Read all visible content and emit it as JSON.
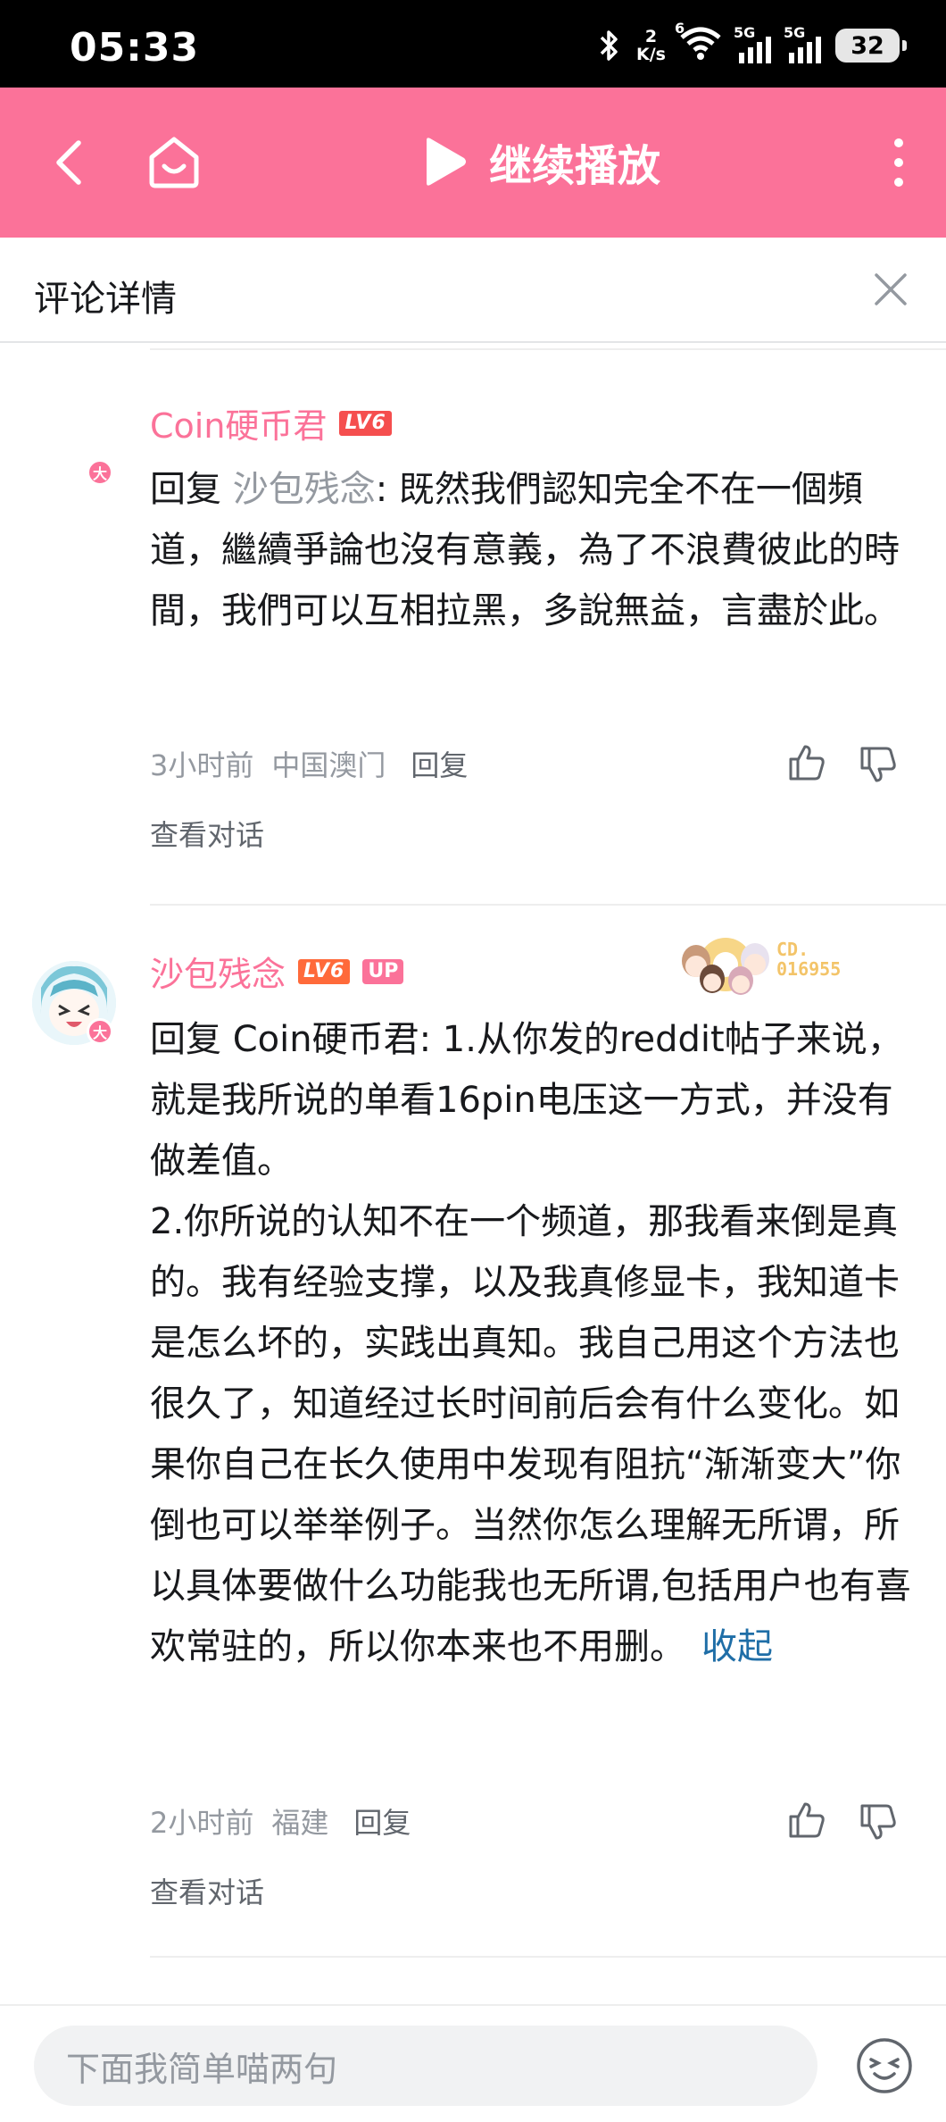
{
  "status_bar": {
    "time": "05:33",
    "net_speed_value": "2",
    "net_speed_unit": "K/s",
    "wifi_label": "6",
    "sim1_label": "5G",
    "sim2_label": "5G",
    "battery": "32"
  },
  "header": {
    "play_title": "继续播放",
    "background_color": "#fb7299"
  },
  "subheader": {
    "title": "评论详情"
  },
  "comments": [
    {
      "username": "Coin硬币君",
      "level": "LV6",
      "badge_letter": "大",
      "reply_prefix": "回复 ",
      "reply_to": "沙包残念",
      "text": ": 既然我們認知完全不在一個頻道，繼續爭論也沒有意義，為了不浪費彼此的時間，我們可以互相拉黑，多說無益，言盡於此。",
      "time": "3小时前",
      "location": "中国澳门",
      "reply_label": "回复",
      "view_conversation": "查看对话"
    },
    {
      "username": "沙包残念",
      "level": "LV6",
      "up_badge": "UP",
      "badge_letter": "大",
      "fan_badge_line1": "CD.",
      "fan_badge_line2": "016955",
      "reply_prefix": "回复 ",
      "reply_to_plain": "Coin硬币君",
      "paragraph1": ": 1.从你发的reddit帖子来说，就是我所说的单看16pin电压这一方式，并没有做差值。",
      "paragraph2": "2.你所说的认知不在一个频道，那我看来倒是真的。我有经验支撑，以及我真修显卡，我知道卡是怎么坏的，实践出真知。我自己用这个方法也很久了，知道经过长时间前后会有什么变化。如果你自己在长久使用中发现有阻抗“渐渐变大”你倒也可以举举例子。当然你怎么理解无所谓，所以具体要做什么功能我也无所谓,包括用户也有喜欢常驻的，所以你本来也不用删。",
      "collapse_label": "收起",
      "time": "2小时前",
      "location": "福建",
      "reply_label": "回复",
      "view_conversation": "查看对话"
    }
  ],
  "bottom_bar": {
    "input_placeholder": "下面我简单喵两句"
  }
}
